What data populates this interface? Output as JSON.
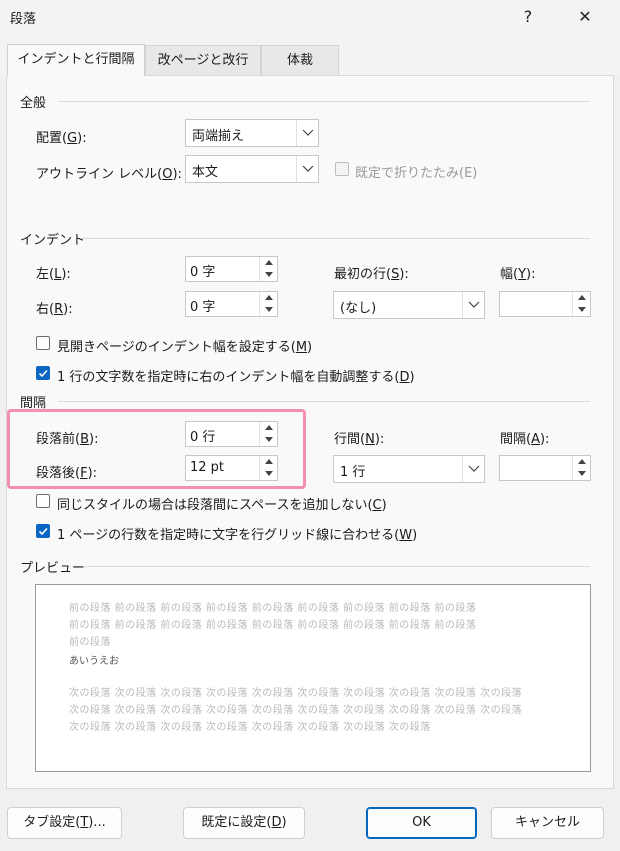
{
  "window": {
    "title": "段落",
    "help": "?",
    "close": "✕"
  },
  "tabs": [
    {
      "label": "インデントと行間隔",
      "active": true
    },
    {
      "label": "改ページと改行",
      "active": false
    },
    {
      "label": "体裁",
      "active": false
    }
  ],
  "general": {
    "section": "全般",
    "alignment": {
      "label": "配置(G):",
      "label_pre": "配置(",
      "key": "G",
      "label_post": "):",
      "value": "両端揃え"
    },
    "outline": {
      "label_pre": "アウトライン レベル(",
      "key": "O",
      "label_post": "):",
      "value": "本文"
    },
    "collapse": {
      "label": "既定で折りたたみ(E)",
      "checked": false,
      "enabled": false
    }
  },
  "indent": {
    "section": "インデント",
    "left": {
      "label_pre": "左(",
      "key": "L",
      "label_post": "):",
      "value": "0 字"
    },
    "right": {
      "label_pre": "右(",
      "key": "R",
      "label_post": "):",
      "value": "0 字"
    },
    "first_line": {
      "label_pre": "最初の行(",
      "key": "S",
      "label_post": "):",
      "value": "(なし)"
    },
    "width": {
      "label_pre": "幅(",
      "key": "Y",
      "label_post": "):",
      "value": ""
    },
    "mirror": {
      "label_pre": "見開きページのインデント幅を設定する(",
      "key": "M",
      "label_post": ")",
      "checked": false
    },
    "auto_adjust": {
      "label_pre": "1 行の文字数を指定時に右のインデント幅を自動調整する(",
      "key": "D",
      "label_post": ")",
      "checked": true
    }
  },
  "spacing": {
    "section": "間隔",
    "before": {
      "label_pre": "段落前(",
      "key": "B",
      "label_post": "):",
      "value": "0 行"
    },
    "after": {
      "label_pre": "段落後(",
      "key": "F",
      "label_post": "):",
      "value": "12 pt"
    },
    "line_spacing": {
      "label_pre": "行間(",
      "key": "N",
      "label_post": "):",
      "value": "1 行"
    },
    "at": {
      "label_pre": "間隔(",
      "key": "A",
      "label_post": "):",
      "value": ""
    },
    "no_space_same_style": {
      "label_pre": "同じスタイルの場合は段落間にスペースを追加しない(",
      "key": "C",
      "label_post": ")",
      "checked": false
    },
    "snap_grid": {
      "label_pre": "1 ページの行数を指定時に文字を行グリッド線に合わせる(",
      "key": "W",
      "label_post": ")",
      "checked": true
    }
  },
  "preview": {
    "section": "プレビュー",
    "prev_lines": [
      "前の段落 前の段落 前の段落 前の段落 前の段落 前の段落 前の段落 前の段落 前の段落",
      "前の段落 前の段落 前の段落 前の段落 前の段落 前の段落 前の段落 前の段落 前の段落",
      "前の段落"
    ],
    "sample": "あいうえお",
    "next_lines": [
      "次の段落 次の段落 次の段落 次の段落 次の段落 次の段落 次の段落 次の段落 次の段落 次の段落",
      "次の段落 次の段落 次の段落 次の段落 次の段落 次の段落 次の段落 次の段落 次の段落 次の段落",
      "次の段落 次の段落 次の段落 次の段落 次の段落 次の段落 次の段落 次の段落"
    ]
  },
  "buttons": {
    "tabs": {
      "label_pre": "タブ設定(",
      "key": "T",
      "label_post": ")..."
    },
    "set_default": {
      "label_pre": "既定に設定(",
      "key": "D",
      "label_post": ")"
    },
    "ok": "OK",
    "cancel": "キャンセル"
  },
  "colors": {
    "accent": "#0a66c2",
    "highlight": "#f48fb1"
  }
}
